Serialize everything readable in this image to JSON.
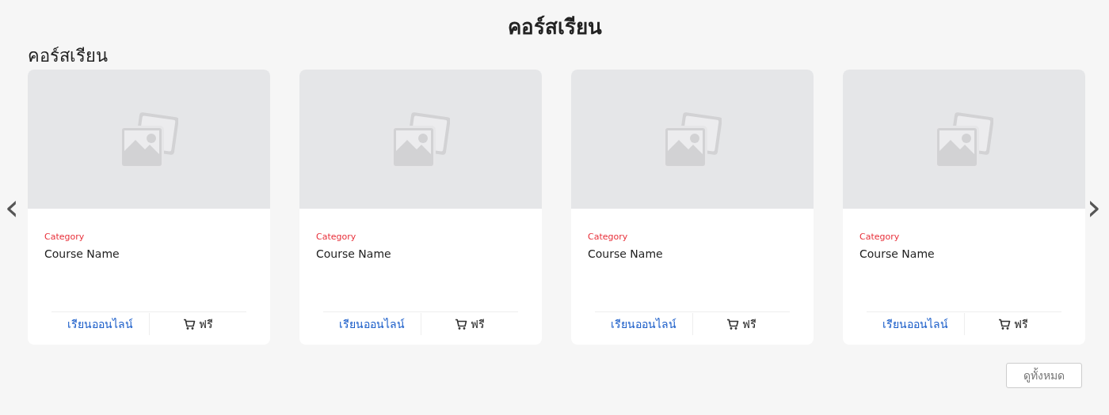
{
  "page_title": "คอร์สเรียน",
  "section": {
    "heading": "คอร์สเรียน"
  },
  "carousel": {
    "prev": "‹",
    "next": "›"
  },
  "courses": [
    {
      "category": "Category",
      "name": "Course Name",
      "action": "เรียนออนไลน์",
      "price": "ฟรี"
    },
    {
      "category": "Category",
      "name": "Course Name",
      "action": "เรียนออนไลน์",
      "price": "ฟรี"
    },
    {
      "category": "Category",
      "name": "Course Name",
      "action": "เรียนออนไลน์",
      "price": "ฟรี"
    },
    {
      "category": "Category",
      "name": "Course Name",
      "action": "เรียนออนไลน์",
      "price": "ฟรี"
    }
  ],
  "view_all": "ดูทั้งหมด"
}
